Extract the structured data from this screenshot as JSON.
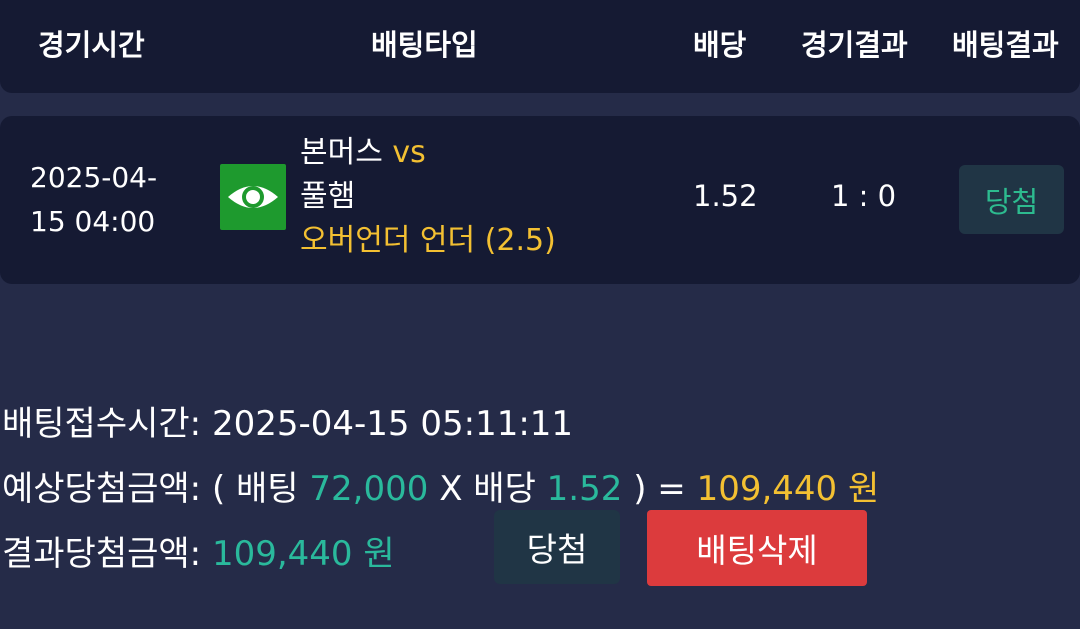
{
  "header": {
    "col_time": "경기시간",
    "col_bet_type": "배팅타입",
    "col_odds": "배당",
    "col_game_result": "경기결과",
    "col_bet_result": "배팅결과"
  },
  "bet_row": {
    "date_line1": "2025-04-",
    "date_line2": "15 04:00",
    "home_team": "본머스",
    "vs": "vs",
    "away_team": "풀햄",
    "market": "오버언더 언더 (2.5)",
    "odds": "1.52",
    "score": "1 : 0",
    "result_badge": "당첨",
    "icon": "eye-icon",
    "icon_bg": "#1e9a2e"
  },
  "summary": {
    "accept_label": "배팅접수시간:",
    "accept_time": "2025-04-15 05:11:11",
    "expected_label": "예상당첨금액:",
    "open_paren": "( 배팅",
    "stake": "72,000",
    "times_text": "X 배당",
    "odds": "1.52",
    "close_eq": ") =",
    "expected_amount": "109,440 원",
    "result_label": "결과당첨금액:",
    "result_amount": "109,440 원"
  },
  "actions": {
    "win_button": "당첨",
    "delete_button": "배팅삭제"
  },
  "colors": {
    "background": "#252b48",
    "card": "#151a33",
    "gold": "#f3c032",
    "teal": "#2ab99c",
    "danger": "#dc3b3d"
  }
}
